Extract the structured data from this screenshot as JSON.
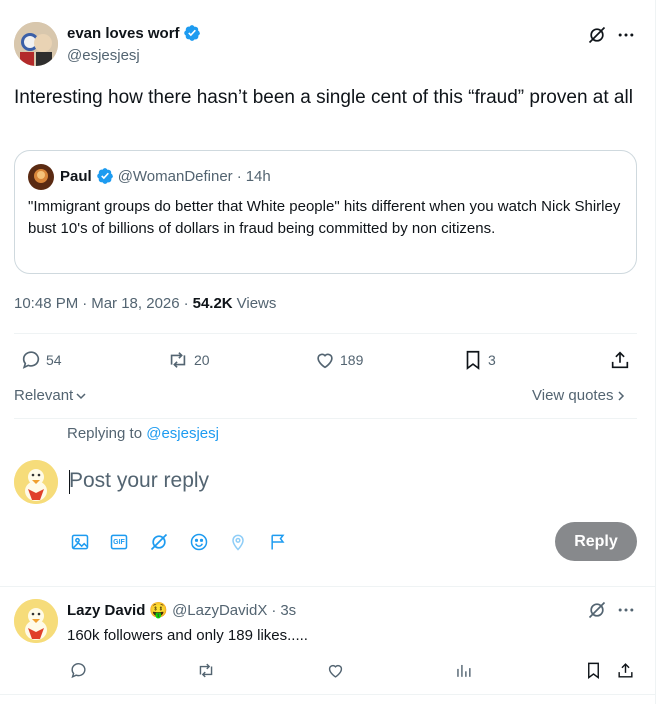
{
  "tweet": {
    "author_name": "evan loves worf",
    "author_handle": "@esjesjesj",
    "text": "Interesting how there hasn’t been a single cent of this “fraud” proven at all",
    "time": "10:48 PM",
    "date": "Mar 18, 2026",
    "views_count": "54.2K",
    "views_label": "Views",
    "sep1": "·",
    "sep2": "·"
  },
  "quote": {
    "author_name": "Paul",
    "author_handle": "@WomanDefiner",
    "sep": "·",
    "age": "14h",
    "text": "\"Immigrant groups do better that White people\" hits different when you watch Nick Shirley bust 10's of billions of dollars in fraud being committed by non citizens."
  },
  "actions": {
    "replies": "54",
    "reposts": "20",
    "likes": "189",
    "bookmarks": "3"
  },
  "sort": {
    "label": "Relevant",
    "view_quotes": "View quotes"
  },
  "compose": {
    "replying_to_prefix": "Replying to",
    "replying_to_handle": "@esjesjesj",
    "placeholder": "Post your reply",
    "reply_button": "Reply",
    "gif_label": "GIF"
  },
  "reply": {
    "author_name": "Lazy David",
    "author_emoji": "🤑",
    "author_handle": "@LazyDavidX",
    "sep": "·",
    "age": "3s",
    "text": "160k followers and only 189 likes....."
  },
  "colors": {
    "accent": "#1d9bf0",
    "text": "#0f1419",
    "muted": "#536471",
    "reply_button_bg": "#87898c"
  },
  "icons": [
    "grok-icon",
    "more-icon",
    "verified-badge-icon",
    "reply-icon",
    "repost-icon",
    "like-icon",
    "bookmark-icon",
    "share-icon",
    "chevron-down-icon",
    "chevron-right-icon",
    "image-icon",
    "gif-icon",
    "grok-icon",
    "emoji-icon",
    "location-icon",
    "poll-flag-icon",
    "views-icon"
  ]
}
